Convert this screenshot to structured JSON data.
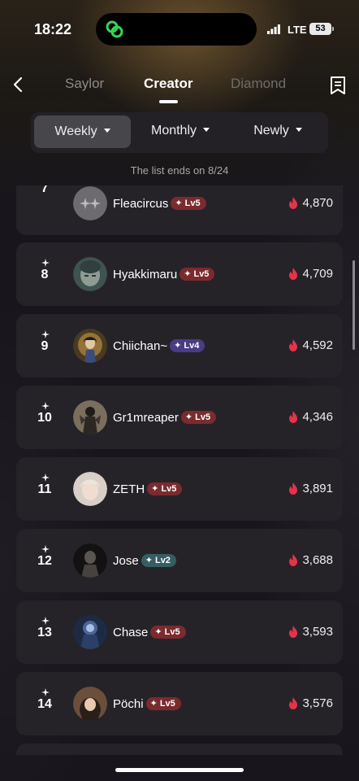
{
  "status_bar": {
    "time": "18:22",
    "network": "LTE",
    "battery": "53"
  },
  "tabs": [
    {
      "label": "Saylor",
      "active": false
    },
    {
      "label": "Creator",
      "active": true
    },
    {
      "label": "Diamond",
      "active": false
    }
  ],
  "periods": [
    {
      "label": "Weekly",
      "active": true
    },
    {
      "label": "Monthly",
      "active": false
    },
    {
      "label": "Newly",
      "active": false
    }
  ],
  "list_end_note": "The list ends on 8/24",
  "entries": [
    {
      "rank": "7",
      "name": "Fleacircus",
      "level": "Lv5",
      "level_color": "red",
      "score": "4,870"
    },
    {
      "rank": "8",
      "name": "Hyakkimaru",
      "level": "Lv5",
      "level_color": "red",
      "score": "4,709"
    },
    {
      "rank": "9",
      "name": "Chiichan~",
      "level": "Lv4",
      "level_color": "purple",
      "score": "4,592"
    },
    {
      "rank": "10",
      "name": "Gr1mreaper",
      "level": "Lv5",
      "level_color": "red",
      "score": "4,346"
    },
    {
      "rank": "11",
      "name": "ZETH",
      "level": "Lv5",
      "level_color": "red",
      "score": "3,891"
    },
    {
      "rank": "12",
      "name": "Jose",
      "level": "Lv2",
      "level_color": "teal",
      "score": "3,688"
    },
    {
      "rank": "13",
      "name": "Chase",
      "level": "Lv5",
      "level_color": "red",
      "score": "3,593"
    },
    {
      "rank": "14",
      "name": "Pöchi",
      "level": "Lv5",
      "level_color": "red",
      "score": "3,576"
    }
  ],
  "colors": {
    "accent_fire": "#e8324a",
    "background": "#18161c"
  }
}
